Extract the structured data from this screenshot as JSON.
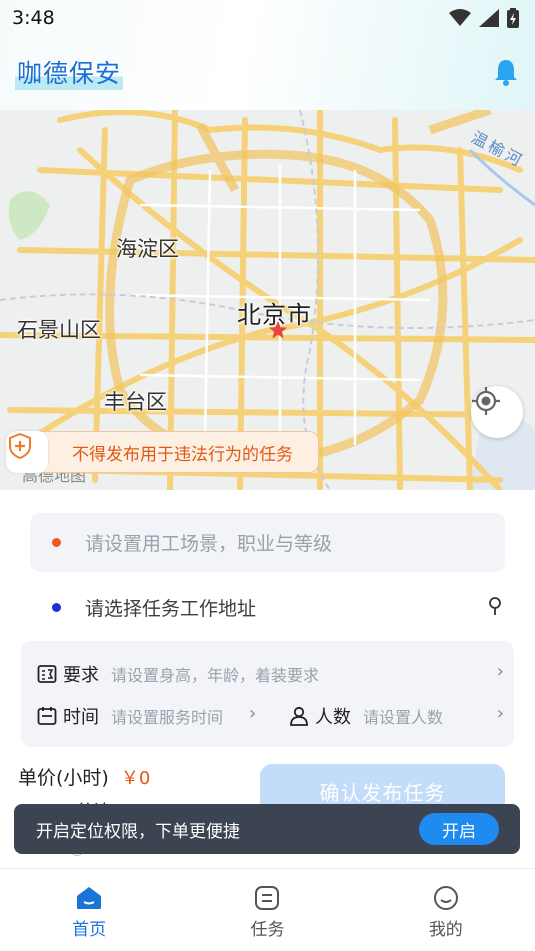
{
  "status_bar": {
    "time": "3:48"
  },
  "header": {
    "title": "咖德保安"
  },
  "map": {
    "labels": {
      "haidian": "海淀区",
      "beijing": "北京市",
      "shijingshan": "石景山区",
      "fengtai": "丰台区",
      "river": "温榆河"
    },
    "warning": "不得发布用于违法行为的任务",
    "attribution": "高德地图"
  },
  "form": {
    "scene_placeholder": "请设置用工场景，职业与等级",
    "address_placeholder": "请选择任务工作地址",
    "requirements_label": "要求",
    "requirements_placeholder": "请设置身高，年龄，着装要求",
    "time_label": "时间",
    "time_placeholder": "请设置服务时间",
    "headcount_label": "人数",
    "headcount_placeholder": "请设置人数",
    "unit_price_label": "单价(小时)",
    "unit_price_value": "￥0",
    "total_label": "总计",
    "confirm_label": "确认发布任务"
  },
  "toast": {
    "message": "开启定位权限，下单更便捷",
    "action": "开启"
  },
  "nav": {
    "items": [
      {
        "label": "首页",
        "icon": "home-icon",
        "active": true
      },
      {
        "label": "任务",
        "icon": "task-icon",
        "active": false
      },
      {
        "label": "我的",
        "icon": "profile-icon",
        "active": false
      }
    ]
  },
  "colors": {
    "brand_blue": "#1a73d9",
    "warning_orange": "#e05a14",
    "price_orange": "#e8541a",
    "scene_dot": "#f05a1e",
    "address_dot": "#1a2fd6",
    "confirm_disabled": "#c3dcfa",
    "toast_bg": "#3c4351",
    "toast_button": "#1f8af0"
  }
}
